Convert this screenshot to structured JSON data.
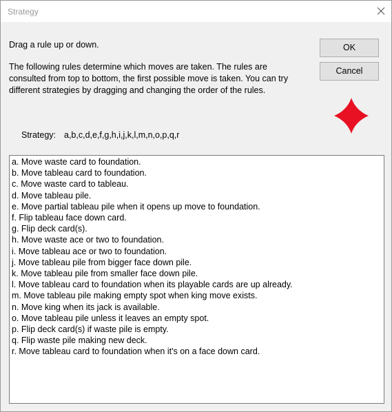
{
  "window": {
    "title": "Strategy"
  },
  "dialog": {
    "instruction": "Drag a rule up or down.",
    "description": "The following rules determine which moves are taken. The rules are consulted from top to bottom, the first possible move is taken.  You can try different strategies by dragging and changing the order of the rules.",
    "ok_label": "OK",
    "cancel_label": "Cancel",
    "strategy_label": "Strategy:",
    "strategy_value": "a,b,c,d,e,f,g,h,i,j,k,l,m,n,o,p,q,r"
  },
  "rules": [
    "a. Move waste card to foundation.",
    "b. Move tableau card to foundation.",
    "c. Move waste card to tableau.",
    "d. Move tableau pile.",
    "e. Move partial tableau pile when it opens up move to foundation.",
    "f. Flip tableau face down card.",
    "g. Flip deck card(s).",
    "h. Move waste ace or two to foundation.",
    "i. Move tableau ace or two to foundation.",
    "j. Move tableau pile from bigger face down pile.",
    "k. Move tableau pile from smaller face down pile.",
    "l. Move tableau card to foundation when its playable cards are up already.",
    "m. Move tableau pile making empty spot when king move exists.",
    "n. Move king when its jack is available.",
    "o. Move tableau pile unless it leaves an empty spot.",
    "p. Flip deck card(s) if waste pile is empty.",
    "q. Flip waste pile making new deck.",
    "r. Move tableau card to foundation when it's on a face down card."
  ],
  "icons": {
    "close": "close-icon",
    "suit": "diamond-icon"
  },
  "colors": {
    "diamond": "#e81123",
    "title_text": "#9a9a9a",
    "dialog_bg": "#f0f0f0"
  }
}
